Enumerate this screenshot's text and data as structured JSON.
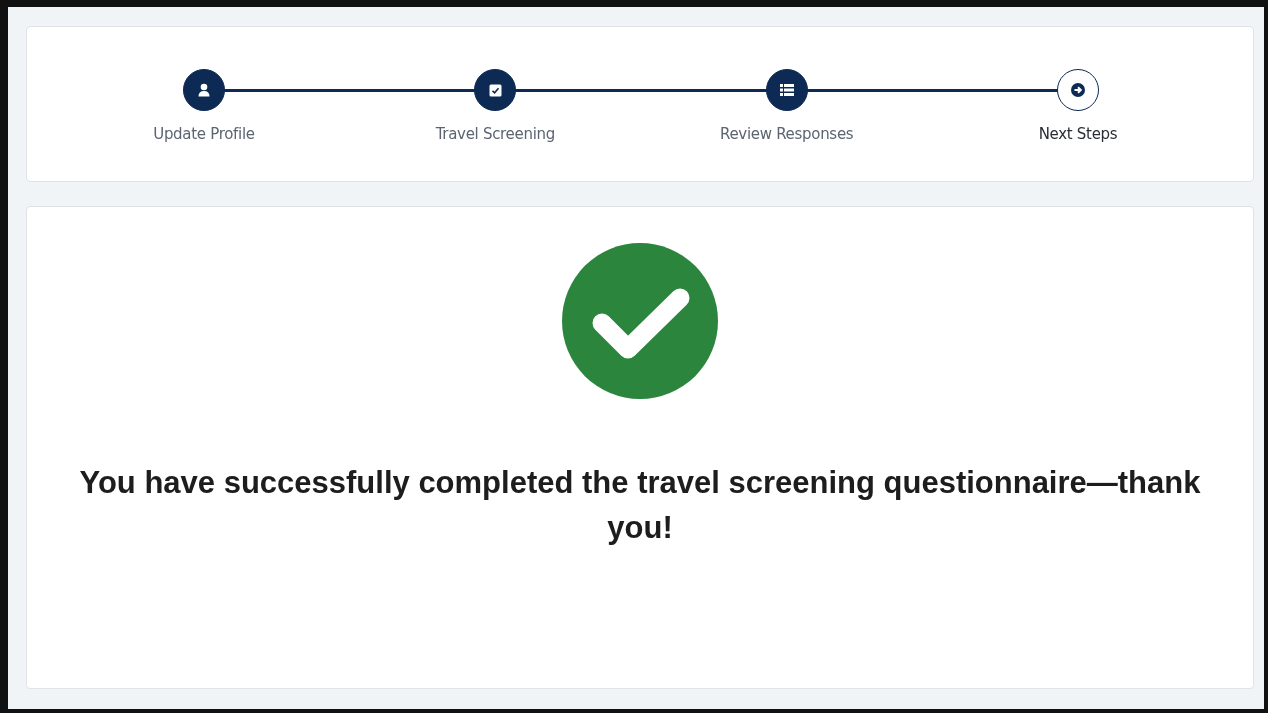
{
  "steps": [
    {
      "label": "Update Profile",
      "completed": true
    },
    {
      "label": "Travel Screening",
      "completed": true
    },
    {
      "label": "Review Responses",
      "completed": true
    },
    {
      "label": "Next Steps",
      "completed": false
    }
  ],
  "message": "You have successfully completed the travel screening questionnaire—thank you!"
}
